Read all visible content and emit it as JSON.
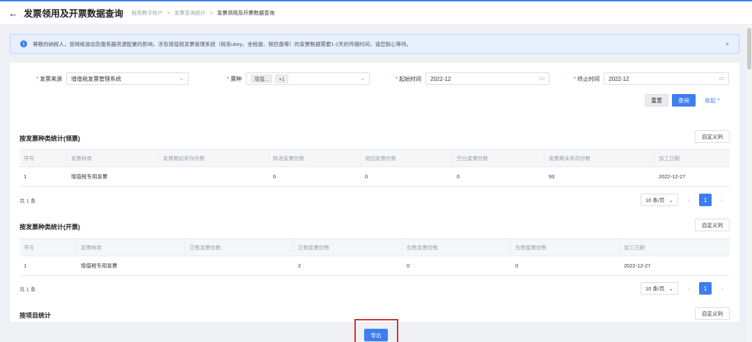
{
  "header": {
    "back_icon": "left-arrow",
    "title": "发票领用及开票数据查询",
    "breadcrumb": [
      "税务数字账户",
      "发票查询统计",
      "发票领用及开票数据查询"
    ],
    "separator": ">"
  },
  "notice": {
    "text": "尊敬的纳税人，受网络波动及服务器资源配置的影响，涉及增值税发票管理系统（税务ukey、金税盘、税控盘等）的发票数据需要1-2天的传输时间，请您耐心等待。",
    "close": "×"
  },
  "filters": {
    "source": {
      "label": "发票来源",
      "value": "增值税发票管理系统"
    },
    "type": {
      "label": "票种",
      "tag1": "增值...",
      "tag2": "+1"
    },
    "start": {
      "label": "起始时间",
      "value": "2022-12"
    },
    "end": {
      "label": "终止时间",
      "value": "2022-12"
    },
    "required_mark": "*",
    "reset": "重置",
    "query": "查询",
    "collapse": "收起 ^"
  },
  "section1": {
    "title": "按发票种类统计(领票)",
    "custom": "自定义列",
    "columns": [
      "序号",
      "发票种类",
      "发票期初库存份数",
      "购进发票份数",
      "退回发票份数",
      "空白废票份数",
      "发票期末库存份数",
      "加工日期"
    ],
    "rows": [
      [
        "1",
        "增值税专用发票",
        "",
        "0",
        "0",
        "0",
        "93",
        "2022-12-27"
      ]
    ],
    "total": "共 1 条",
    "page_size": "10 条/页",
    "page": "1"
  },
  "section2": {
    "title": "按发票种类统计(开票)",
    "custom": "自定义列",
    "columns": [
      "序号",
      "发票种类",
      "正数发票份数",
      "正数废票份数",
      "负数发票份数",
      "负数废票份数",
      "加工日期"
    ],
    "rows": [
      [
        "1",
        "增值税专用发票",
        "",
        "2",
        "0",
        "0",
        "2022-12-27"
      ]
    ],
    "total": "共 1 条",
    "page_size": "10 条/页",
    "page": "1"
  },
  "section3": {
    "title": "按项目统计",
    "custom": "自定义列"
  },
  "export": "导出",
  "colors": {
    "accent": "#3d7ef0",
    "highlight": "#d42b2b",
    "notice_bg": "#e6f0ff"
  }
}
